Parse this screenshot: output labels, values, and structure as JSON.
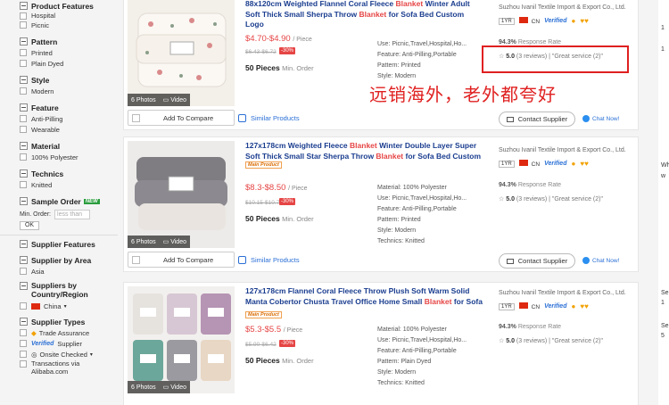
{
  "sidebar": {
    "product_features_title": "Product Features",
    "product_features_items": [
      "Hospital",
      "Picnic"
    ],
    "pattern_title": "Pattern",
    "pattern_items": [
      "Printed",
      "Plain Dyed"
    ],
    "style_title": "Style",
    "style_items": [
      "Modern"
    ],
    "feature_title": "Feature",
    "feature_items": [
      "Anti-Pilling",
      "Wearable"
    ],
    "material_title": "Material",
    "material_items": [
      "100% Polyester"
    ],
    "technics_title": "Technics",
    "technics_items": [
      "Knitted"
    ],
    "sample_order_title": "Sample Order",
    "new_badge": "NEW",
    "min_order_label": "Min. Order:",
    "min_order_placeholder": "less than",
    "ok_label": "OK",
    "supplier_features_title": "Supplier Features",
    "supplier_by_area_title": "Supplier by Area",
    "area_items": [
      "Asia"
    ],
    "suppliers_by_country_title": "Suppliers by Country/Region",
    "country_items": [
      "China"
    ],
    "supplier_types_title": "Supplier Types",
    "trade_assurance": "Trade Assurance",
    "verified_label": "Verified",
    "supplier_label": "Supplier",
    "onsite_checked": "Onsite Checked",
    "transactions_via": "Transactions via",
    "alibaba": "Alibaba.com"
  },
  "overlay": {
    "text": "远销海外，老外都夸好",
    "highlight_color": "#e02020"
  },
  "products": [
    {
      "title_pre": "88x120cm Weighted Flannel Coral Fleece ",
      "kw1": "Blanket",
      "title_mid": " Winter Adult Soft Thick Small Sherpa Throw ",
      "kw2": "Blanket",
      "title_post": " for Sofa Bed Custom Logo",
      "main_product": "",
      "price": "$4.70-$4.90",
      "unit": "/ Piece",
      "old_price": "$6.43-$6.72",
      "discount": "-30%",
      "moq": "50 Pieces",
      "moq_label": "Min. Order",
      "material": "",
      "use": "Use: Picnic,Travel,Hospital,Ho...",
      "feature": "Feature: Anti-Pilling,Portable",
      "pattern": "Pattern: Printed",
      "style": "Style: Modern",
      "technics": "",
      "photos": "6 Photos",
      "video": "Video",
      "supplier": "Suzhou Ivanil Textile Import & Export Co., Ltd.",
      "year": "1YR",
      "country": "CN",
      "verified": "Verified",
      "response_rate": "94.3%",
      "response_label": "Response Rate",
      "rating": "5.0",
      "reviews": "(3 reviews)",
      "service": "\"Great service (2)\"",
      "compare": "Add To Compare",
      "similar": "Similar Products",
      "contact": "Contact Supplier",
      "chat": "Chat Now!"
    },
    {
      "title_pre": "127x178cm Weighted Fleece ",
      "kw1": "Blanket",
      "title_mid": " Winter Double Layer Super Soft Thick Small Star Sherpa Throw ",
      "kw2": "Blanket",
      "title_post": " for Sofa Bed Custom",
      "main_product": "Main Product",
      "price": "$8.3-$8.50",
      "unit": "/ Piece",
      "old_price": "$10.15-$10.72",
      "discount": "-30%",
      "moq": "50 Pieces",
      "moq_label": "Min. Order",
      "material": "Material: 100% Polyester",
      "use": "Use: Picnic,Travel,Hospital,Ho...",
      "feature": "Feature: Anti-Pilling,Portable",
      "pattern": "Pattern: Printed",
      "style": "Style: Modern",
      "technics": "Technics: Knitted",
      "photos": "6 Photos",
      "video": "Video",
      "supplier": "Suzhou Ivanil Textile Import & Export Co., Ltd.",
      "year": "1YR",
      "country": "CN",
      "verified": "Verified",
      "response_rate": "94.3%",
      "response_label": "Response Rate",
      "rating": "5.0",
      "reviews": "(3 reviews)",
      "service": "\"Great service (2)\"",
      "compare": "Add To Compare",
      "similar": "Similar Products",
      "contact": "Contact Supplier",
      "chat": "Chat Now!"
    },
    {
      "title_pre": "127x178cm Flannel Coral Fleece Throw Plush Soft Warm Solid Manta Cobertor Chusta Travel Office Home Small ",
      "kw1": "Blanket",
      "title_mid": " for Sofa",
      "kw2": "",
      "title_post": "",
      "main_product": "Main Product",
      "price": "$5.3-$5.5",
      "unit": "/ Piece",
      "old_price": "$5.90-$6.42",
      "discount": "-30%",
      "moq": "50 Pieces",
      "moq_label": "Min. Order",
      "material": "Material: 100% Polyester",
      "use": "Use: Picnic,Travel,Hospital,Ho...",
      "feature": "Feature: Anti-Pilling,Portable",
      "pattern": "Pattern: Plain Dyed",
      "style": "Style: Modern",
      "technics": "Technics: Knitted",
      "photos": "6 Photos",
      "video": "Video",
      "supplier": "Suzhou Ivanil Textile Import & Export Co., Ltd.",
      "year": "1YR",
      "country": "CN",
      "verified": "Verified",
      "response_rate": "94.3%",
      "response_label": "Response Rate",
      "rating": "5.0",
      "reviews": "(3 reviews)",
      "service": "\"Great service (2)\""
    }
  ],
  "right_edge": {
    "lines": [
      "1",
      "1",
      "Wh",
      "w",
      "Se",
      "1",
      "Se",
      "5"
    ]
  }
}
